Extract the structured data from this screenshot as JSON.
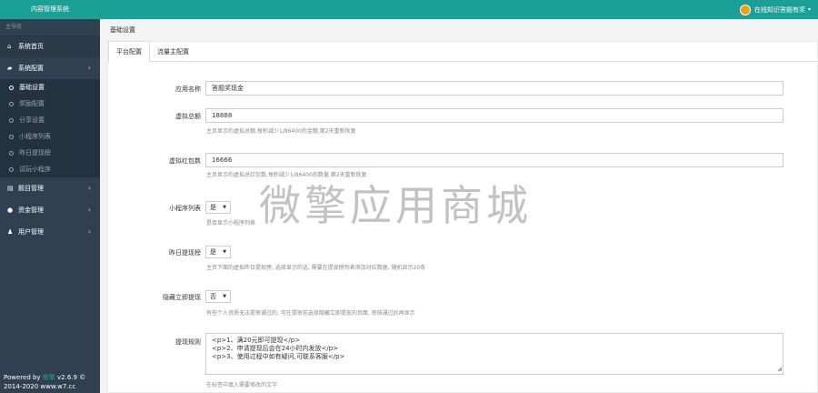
{
  "app": {
    "title": "内容管理系统"
  },
  "user": {
    "name": "在线知识答题有奖"
  },
  "sidebar": {
    "nav_header": "主导航",
    "home": "系统首页",
    "config": "系统配置",
    "config_items": [
      "基础设置",
      "奖励配置",
      "分享设置",
      "小程序列表",
      "昨日提现榜",
      "试玩小程序"
    ],
    "topics": "题目管理",
    "funds": "资金管理",
    "users": "用户管理",
    "footer_line1_prefix": "Powered by ",
    "footer_brand": "微擎",
    "footer_line1_suffix": " v2.6.9 ©",
    "footer_line2": "2014-2020 www.w7.cc"
  },
  "page": {
    "breadcrumb": "基础设置",
    "tabs": [
      "平台配置",
      "流量主配置"
    ]
  },
  "form": {
    "app_name": {
      "label": "应用名称",
      "value": "答题奖现金"
    },
    "virtual_total": {
      "label": "虚拟总额",
      "value": "18888",
      "help": "主页显示的虚拟总额,每秒减少1/86400的金额,第2天重新恢复"
    },
    "virtual_packets": {
      "label": "虚拟红包数",
      "value": "16666",
      "help": "主页显示的虚拟总红包数,每秒减少1/86400的数量,第2天重新恢复"
    },
    "mini_list": {
      "label": "小程序列表",
      "value": "是",
      "help": "是否显示小程序列表"
    },
    "yesterday_rank": {
      "label": "昨日提现榜",
      "value": "是",
      "help": "主页下面的虚拟昨日提现榜, 选择显示的话, 需要在提现榜列表添加对应数据, 随机显示20条"
    },
    "hide_withdraw": {
      "label": "隐藏立即提现",
      "value": "否",
      "help": "有些个人资质无法提审通过的, 可在提审前选择隐藏立即提现的页面, 审核通过后再显示"
    },
    "withdraw_rules": {
      "label": "提现规则",
      "lines": [
        "<p>1、满20元即可提现</p>",
        "<p>2、申请提现后会在24小时内发放</p>",
        "<p>3、使用过程中如有疑问,可联系客服</p>"
      ],
      "help": "在标签中填入需要修改的文字"
    }
  },
  "watermark": "微擎应用商城",
  "colors": {
    "topbar": "#1aa094",
    "sidebar": "#2f4050"
  }
}
